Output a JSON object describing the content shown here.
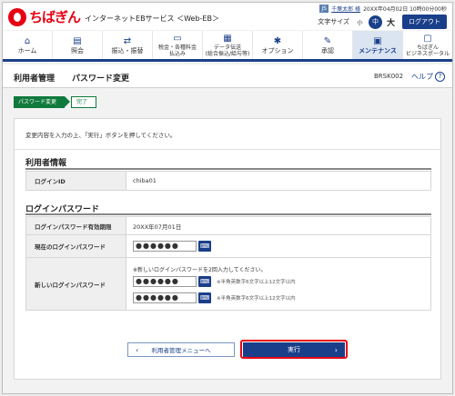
{
  "header": {
    "brand": "ちばぎん",
    "service": "インターネットEBサービス ＜Web-EB＞",
    "user_name": "千葉太郎 様",
    "last_login": "20XX年04月02日 10時00分00秒",
    "font_size_label": "文字サイズ",
    "font_sizes": [
      "小",
      "中",
      "大"
    ],
    "logout_label": "ログアウト"
  },
  "nav": [
    {
      "icon": "home-icon",
      "label": "ホーム"
    },
    {
      "icon": "inquiry-icon",
      "label": "照会"
    },
    {
      "icon": "transfer-icon",
      "label": "振込・振替"
    },
    {
      "icon": "tax-payment-icon",
      "label": "税金・各種料金\n払込み"
    },
    {
      "icon": "data-transfer-icon",
      "label": "データ伝送\n(総合振込/給与等)"
    },
    {
      "icon": "option-icon",
      "label": "オプション"
    },
    {
      "icon": "approval-icon",
      "label": "承認"
    },
    {
      "icon": "maintenance-icon",
      "label": "メンテナンス"
    },
    {
      "icon": "portal-icon",
      "label": "ちばぎん\nビジネスポータル"
    }
  ],
  "title": {
    "category": "利用者管理",
    "main": "パスワード変更",
    "screen_id": "BRSK002",
    "help_label": "ヘルプ",
    "help_icon": "?"
  },
  "steps": {
    "current": "パスワード変更",
    "next": "完了"
  },
  "instruction": "変更内容を入力の上、「実行」ボタンを押してください。",
  "user_info": {
    "section_title": "利用者情報",
    "login_id_label": "ログインID",
    "login_id_value": "chiba01"
  },
  "password": {
    "section_title": "ログインパスワード",
    "expiry_label": "ログインパスワード有効期限",
    "expiry_value": "20XX年07月01日",
    "current_label": "現在のログインパスワード",
    "current_value": "●●●●●●",
    "new_label": "新しいログインパスワード",
    "new_hint": "※新しいログインパスワードを2回入力してください。",
    "new_value_1": "●●●●●●",
    "new_value_2": "●●●●●●",
    "new_note": "※半角英数字6文字以上12文字以内"
  },
  "buttons": {
    "back_label": "利用者管理メニューへ",
    "execute_label": "実行"
  },
  "colors": {
    "brand_red": "#e60012",
    "navy": "#1a3f8a",
    "step_green": "#0f7a3c"
  }
}
